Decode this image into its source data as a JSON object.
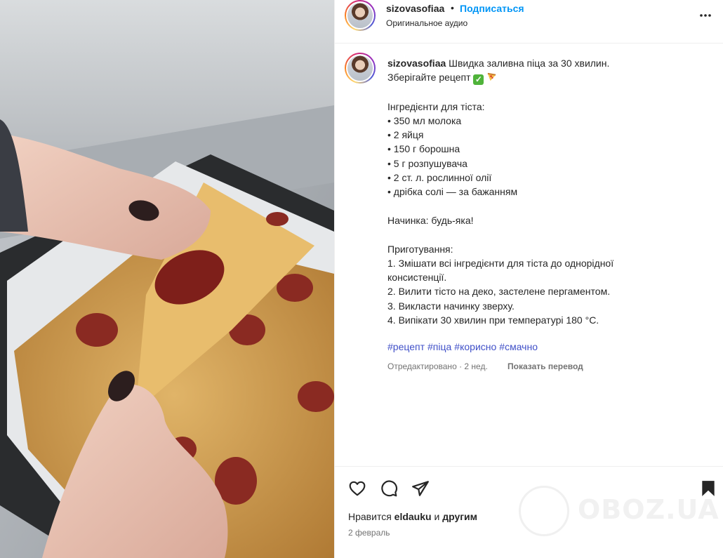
{
  "header": {
    "username": "sizovasofiaa",
    "dot": "•",
    "follow_label": "Подписаться",
    "audio": "Оригинальное аудио"
  },
  "caption": {
    "username": "sizovasofiaa",
    "line1": "Швидка заливна піца за 30 хвилин.",
    "line2_text": "Зберігайте рецепт",
    "check_emoji": "✓",
    "body": "Інгредієнти для тіста:\n• 350 мл молока\n• 2 яйця\n• 150 г борошна\n• 5 г розпушувача\n• 2 ст. л. рослинної олії\n• дрібка солі — за бажанням\n\nНачинка: будь-яка!\n\nПриготування:\n1. Змішати всі інгредієнти для тіста до однорідної\nконсистенції.\n2. Вилити тісто на деко, застелене пергаментом.\n3. Викласти начинку зверху.\n4. Випікати 30 хвилин при температурі 180 °C.",
    "hashtags": [
      "#рецепт",
      "#піца",
      "#корисно",
      "#смачно"
    ],
    "meta": "Отредактировано · 2 нед.",
    "translate_label": "Показать перевод"
  },
  "actions": {
    "likes_prefix": "Нравится",
    "likes_user": "eldauku",
    "likes_conj": "и",
    "likes_others": "другим",
    "date": "2 февраль"
  },
  "watermark": {
    "text": "OBOZ.UA"
  },
  "colors": {
    "link": "#0095f6",
    "hashtag": "#4050c8",
    "muted": "#737373"
  },
  "icons": [
    "more-icon",
    "heart-icon",
    "comment-icon",
    "share-icon",
    "bookmark-icon",
    "check-emoji",
    "pizza-emoji"
  ]
}
